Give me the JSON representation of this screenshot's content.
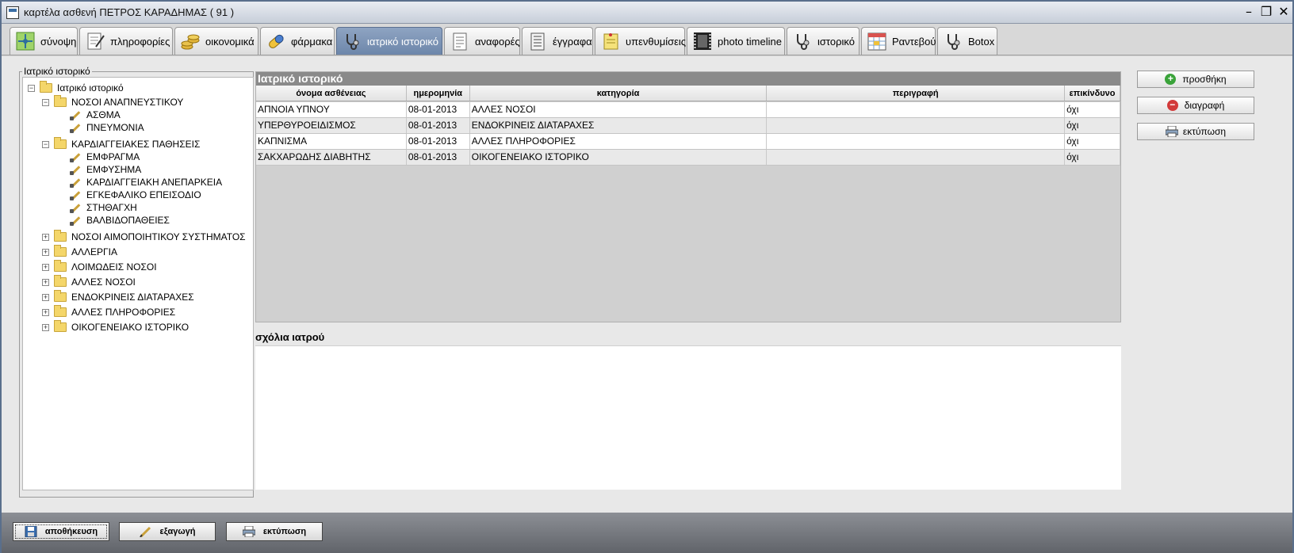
{
  "window": {
    "title": "καρτέλα ασθενή ΠΕΤΡΟΣ ΚΑΡΑΔΗΜΑΣ ( 91 )",
    "controls": [
      "minimize",
      "maximize",
      "close"
    ]
  },
  "tabs": [
    {
      "label": "σύνοψη",
      "icon": "overview-icon"
    },
    {
      "label": "πληροφορίες",
      "icon": "info-icon"
    },
    {
      "label": "οικονομικά",
      "icon": "coins-icon"
    },
    {
      "label": "φάρμακα",
      "icon": "pill-icon"
    },
    {
      "label": "ιατρικό ιστορικό",
      "icon": "stethoscope-icon",
      "active": true
    },
    {
      "label": "αναφορές",
      "icon": "report-icon"
    },
    {
      "label": "έγγραφα",
      "icon": "document-icon"
    },
    {
      "label": "υπενθυμίσεις",
      "icon": "reminder-note-icon"
    },
    {
      "label": "photo timeline",
      "icon": "film-strip-icon"
    },
    {
      "label": "ιστορικό",
      "icon": "stethoscope-icon"
    },
    {
      "label": "Ραντεβού",
      "icon": "calendar-icon"
    },
    {
      "label": "Botox",
      "icon": "stethoscope-icon"
    }
  ],
  "tree": {
    "frame_label": "Ιατρικό ιστορικό",
    "root": "Ιατρικό ιστορικό",
    "groups": [
      {
        "label": "ΝΟΣΟΙ ΑΝΑΠΝΕΥΣΤΙΚΟΥ",
        "expanded": true,
        "items": [
          "ΑΣΘΜΑ",
          "ΠΝΕΥΜΟΝΙΑ"
        ]
      },
      {
        "label": "ΚΑΡΔΙΑΓΓΕΙΑΚΕΣ ΠΑΘΗΣΕΙΣ",
        "expanded": true,
        "items": [
          "ΕΜΦΡΑΓΜΑ",
          "ΕΜΦΥΣΗΜΑ",
          "ΚΑΡΔΙΑΓΓΕΙΑΚΗ ΑΝΕΠΑΡΚΕΙΑ",
          "ΕΓΚΕΦΑΛΙΚΟ ΕΠΕΙΣΟΔΙΟ",
          "ΣΤΗΘΑΓΧΗ",
          "ΒΑΛΒΙΔΟΠΑΘΕΙΕΣ"
        ]
      },
      {
        "label": "ΝΟΣΟΙ ΑΙΜΟΠΟΙΗΤΙΚΟΥ ΣΥΣΤΗΜΑΤΟΣ",
        "expanded": false,
        "items": []
      },
      {
        "label": "ΑΛΛΕΡΓΙΑ",
        "expanded": false,
        "items": []
      },
      {
        "label": "ΛΟΙΜΩΔΕΙΣ ΝΟΣΟΙ",
        "expanded": false,
        "items": []
      },
      {
        "label": "ΑΛΛΕΣ ΝΟΣΟΙ",
        "expanded": false,
        "items": []
      },
      {
        "label": "ΕΝΔΟΚΡΙΝΕΙΣ ΔΙΑΤΑΡΑΧΕΣ",
        "expanded": false,
        "items": []
      },
      {
        "label": "ΑΛΛΕΣ ΠΛΗΡΟΦΟΡΙΕΣ",
        "expanded": false,
        "items": []
      },
      {
        "label": "ΟΙΚΟΓΕΝΕΙΑΚΟ ΙΣΤΟΡΙΚΟ",
        "expanded": false,
        "items": []
      }
    ]
  },
  "history_table": {
    "title": "Ιατρικό ιστορικό",
    "columns": [
      "όνομα ασθένειας",
      "ημερομηνία",
      "κατηγορία",
      "περιγραφή",
      "επικίνδυνο"
    ],
    "rows": [
      [
        "ΑΠΝΟΙΑ ΥΠΝΟΥ",
        "08-01-2013",
        "ΑΛΛΕΣ ΝΟΣΟΙ",
        "",
        "όχι"
      ],
      [
        "ΥΠΕΡΘΥΡΟΕΙΔΙΣΜΟΣ",
        "08-01-2013",
        "ΕΝΔΟΚΡΙΝΕΙΣ ΔΙΑΤΑΡΑΧΕΣ",
        "",
        "όχι"
      ],
      [
        "ΚΑΠΝΙΣΜΑ",
        "08-01-2013",
        "ΑΛΛΕΣ ΠΛΗΡΟΦΟΡΙΕΣ",
        "",
        "όχι"
      ],
      [
        "ΣΑΚΧΑΡΩΔΗΣ ΔΙΑΒΗΤΗΣ",
        "08-01-2013",
        "ΟΙΚΟΓΕΝΕΙΑΚΟ ΙΣΤΟΡΙΚΟ",
        "",
        "όχι"
      ]
    ]
  },
  "notes": {
    "label": "σχόλια ιατρού",
    "value": ""
  },
  "side_buttons": {
    "add": "προσθήκη",
    "delete": "διαγραφή",
    "print": "εκτύπωση"
  },
  "bottom_buttons": {
    "save": "αποθήκευση",
    "export": "εξαγωγή",
    "print": "εκτύπωση"
  },
  "colors": {
    "active_tab": "#7d95b8",
    "table_title_bg": "#8a8a8a",
    "add_green": "#3aa33a",
    "delete_red": "#d23a3a"
  }
}
